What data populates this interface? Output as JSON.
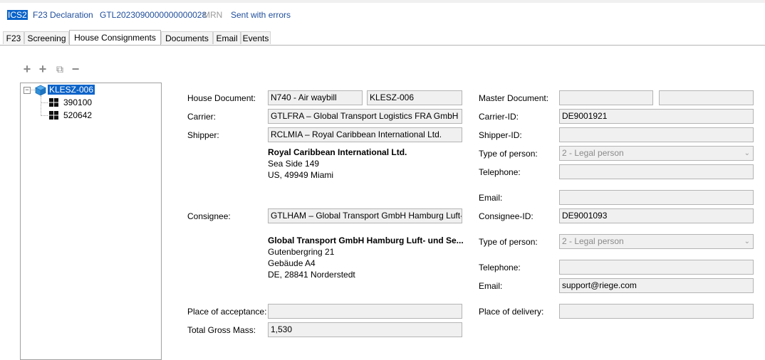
{
  "header": {
    "badge": "ICS2",
    "declaration": "F23 Declaration",
    "reference": "GTL2023090000000000028",
    "mrn": "MRN",
    "status": "Sent with errors"
  },
  "tabs": [
    "F23",
    "Screening",
    "House Consignments",
    "Documents",
    "Email",
    "Events"
  ],
  "toolbar": {
    "add": "+",
    "add_child": "+",
    "copy": "⧉",
    "remove": "−"
  },
  "tree": {
    "root": "KLESZ-006",
    "children": [
      "390100",
      "520642"
    ]
  },
  "labels": {
    "house_document": "House Document:",
    "carrier": "Carrier:",
    "shipper": "Shipper:",
    "consignee": "Consignee:",
    "place_of_acceptance": "Place of acceptance:",
    "total_gross_mass": "Total Gross Mass:",
    "master_document": "Master Document:",
    "carrier_id": "Carrier-ID:",
    "shipper_id": "Shipper-ID:",
    "type_of_person": "Type of person:",
    "telephone": "Telephone:",
    "email": "Email:",
    "consignee_id": "Consignee-ID:",
    "type_of_person_2": "Type of person:",
    "telephone_2": "Telephone:",
    "email_2": "Email:",
    "place_of_delivery": "Place of delivery:"
  },
  "values": {
    "house_doc_type": "N740 - Air waybill",
    "house_doc_number": "KLESZ-006",
    "carrier": "GTLFRA – Global Transport Logistics FRA GmbH",
    "shipper": "RCLMIA – Royal Caribbean International Ltd.",
    "consignee": "GTLHAM – Global Transport GmbH Hamburg Luft-",
    "place_of_acceptance": "",
    "total_gross_mass": "1,530",
    "master_doc_1": "",
    "master_doc_2": "",
    "carrier_id": "DE9001921",
    "shipper_id": "",
    "shipper_type_of_person": "2 - Legal person",
    "shipper_telephone": "",
    "shipper_email": "",
    "consignee_id": "DE9001093",
    "consignee_type_of_person": "2 - Legal person",
    "consignee_telephone": "",
    "consignee_email": "support@riege.com",
    "place_of_delivery": ""
  },
  "shipper_address": {
    "name": "Royal Caribbean International Ltd.",
    "line1": "Sea Side 149",
    "line2": "US, 49949 Miami"
  },
  "consignee_address": {
    "name": "Global Transport GmbH Hamburg Luft- und Se...",
    "line1": "Gutenbergring 21",
    "line2": "Gebäude A4",
    "line3": "DE, 28841 Norderstedt"
  },
  "colors": {
    "accent": "#0a63c9",
    "link": "#1f4e9c",
    "field_bg": "#f0f0f0"
  }
}
